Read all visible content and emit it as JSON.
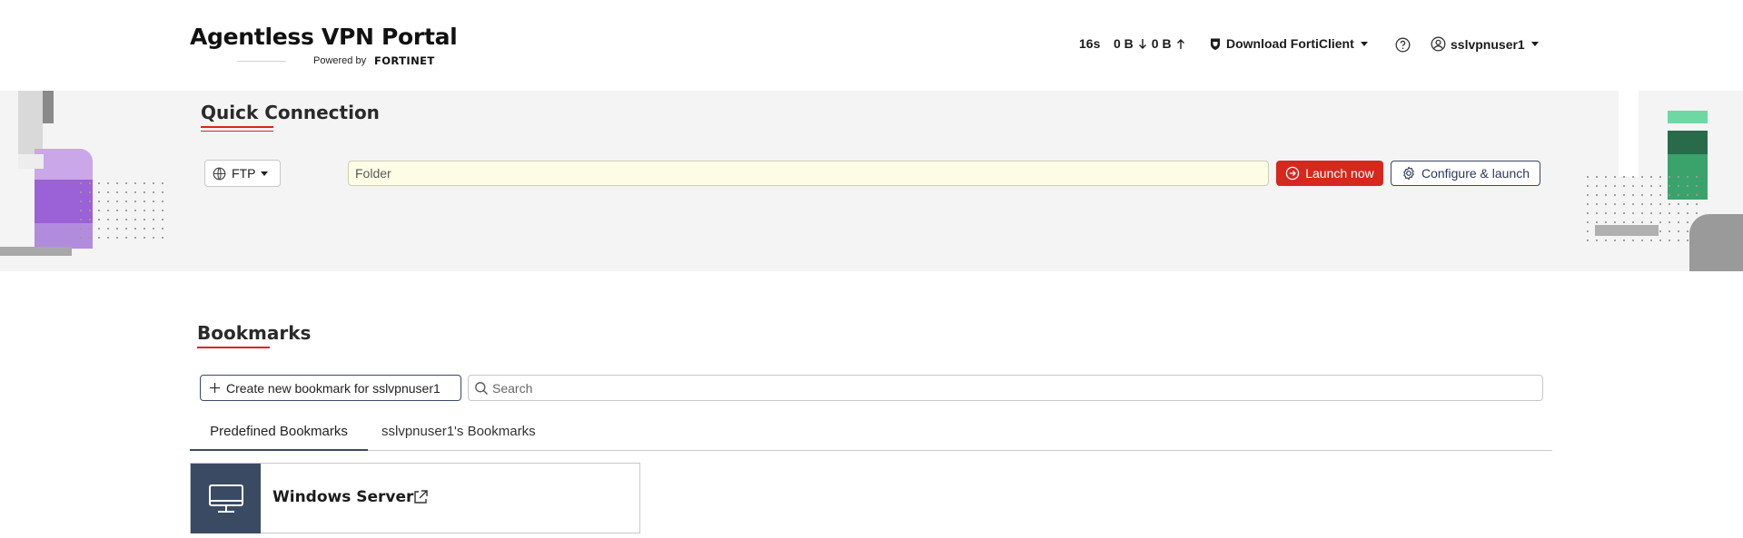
{
  "header": {
    "title": "Agentless VPN Portal",
    "powered_by": "Powered by",
    "vendor_logo": "FORTINET",
    "session_time": "16s",
    "bytes_down": "0 B",
    "bytes_up": "0 B",
    "download_label": "Download FortiClient",
    "help_icon": "help-icon",
    "username": "sslvpnuser1"
  },
  "quick_connection": {
    "title": "Quick Connection",
    "protocol": "FTP",
    "folder_placeholder": "Folder",
    "launch_label": "Launch now",
    "configure_label": "Configure & launch"
  },
  "bookmarks": {
    "title": "Bookmarks",
    "create_label": "Create new bookmark for sslvpnuser1",
    "search_placeholder": "Search",
    "tabs": [
      {
        "label": "Predefined Bookmarks",
        "active": true
      },
      {
        "label": "sslvpnuser1's Bookmarks",
        "active": false
      }
    ],
    "items": [
      {
        "name": "Windows Server",
        "icon": "monitor-icon"
      }
    ]
  },
  "colors": {
    "accent_red": "#d6281d",
    "navy": "#3b4a63",
    "band_bg": "#f4f4f4"
  }
}
